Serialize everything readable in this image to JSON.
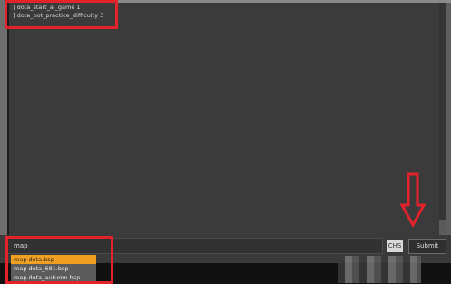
{
  "console": {
    "lines": [
      "] dota_start_ai_game 1",
      "] dota_bot_practice_difficulty 3"
    ]
  },
  "command": {
    "input_value": "map",
    "lang_badge": "CHS",
    "submit_label": "Submit"
  },
  "autocomplete": {
    "items": [
      "map dota.bsp",
      "map dota_681.bsp",
      "map dota_autumn.bsp"
    ],
    "selected_index": 0
  },
  "colors": {
    "annotation": "#e3232b",
    "selected_item": "#f0a020",
    "console_bg": "#3b3b3b"
  }
}
